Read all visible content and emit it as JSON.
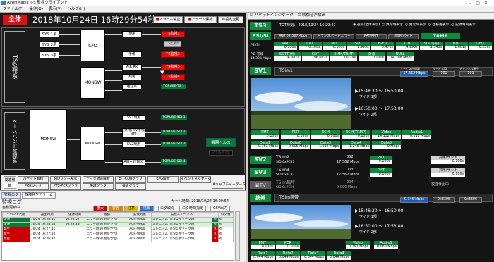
{
  "window": {
    "title": "AvertMagic T-S 監視クライアント"
  },
  "menu": [
    "ファイル(F)",
    "操作(O)",
    "表示(V)",
    "ヘルプ(H)"
  ],
  "left": {
    "zentai": "全体",
    "clock": "2018年10月24日 16時29分54秒",
    "btn_alarm_stop": "アラーム停止",
    "btn_alarm_hold": "アラーム保持",
    "btn_settings": "設定変更",
    "ts_label": "TS監視系",
    "bb_label": "ベースバンド監視系",
    "sys": [
      "SYS 1系",
      "SYS 2系",
      "SYS 3系"
    ],
    "co": "C/O",
    "monsw": "MONSW",
    "lines": [
      "現用",
      "予備",
      "AIR RX",
      "共用",
      "確証系"
    ],
    "ts_red": [
      "TS監視1",
      "TS監視2",
      "TS監視3",
      "TS監視4"
    ],
    "ts_dim": "TS監視5",
    "ts_green1": "TORUBE-TS 1",
    "sv_labels": [
      "SV1現用",
      "(共用) SV予備NT1",
      "SV2現用",
      "AIR+SYDEC"
    ],
    "sdi": [
      "TORUBE-SDI 1",
      "TORUBE-SDI 2",
      "TORUBE-SDI 3",
      "TORUBE-SDI 4"
    ],
    "equip_label": "機器ヘルス",
    "equip_sub": "SYSTEM OK",
    "kanren": "関連機能",
    "keys_row1": [
      "パケット解析",
      "PIDリソー表示",
      "データ放送解析",
      "EIT-CDRグラフ",
      "EPG解析",
      "イベントメッセージ"
    ],
    "keys_row2": [
      "PCRジッタ",
      "PTS-PCRグラフ",
      "帯域グラフ",
      "番組グラフ",
      "キャプチャーデータ"
    ]
  },
  "log": {
    "tabs": [
      "監視ログ",
      "故障発生アラーム"
    ],
    "header": "監視ログ",
    "subheader": "自動更新中",
    "filters": [
      "重大",
      "警告",
      "注意",
      "情報"
    ],
    "btn_copy": "ログ取得",
    "btn_search": "ログ時刻指定",
    "btn_csv": "CSV出力",
    "server_time_label": "サーバ時刻",
    "server_time": "2018/10/24 16:29:54",
    "columns": [
      "イベント内容",
      "発生時刻",
      "復帰時刻",
      "機器",
      "監視対象",
      "監視ステータス",
      "",
      "ログ種"
    ],
    "rows": [
      [
        "復帰",
        "10/24 16:28:51",
        "16:28:52",
        "エラー時刻(地址予告)",
        "ACR-9000",
        "ミレニアム（TS監視ワーク時）",
        "G",
        "有"
      ],
      [
        "復帰",
        "10/24 16:28:14",
        "16:28:48",
        "エラー時刻(地址予告)",
        "ACR-9000",
        "ミレニアム（TS監視ワーク時）",
        "G",
        "有"
      ],
      [
        "発生",
        "10/24 16:27:41",
        "",
        "エラー時刻(地址予告)",
        "ACR-9000",
        "ミレニアム（TS監視ワーク時）",
        "R",
        "有"
      ],
      [
        "発生",
        "10/24 16:27:10",
        "",
        "エラー時刻(地址予告)",
        "ACR-9000",
        "ミレニアム（TS監視ワーク時）",
        "R",
        "有"
      ],
      [
        "発生",
        "10/24 16:26:32",
        "",
        "エラー時刻(地址予告)",
        "ACR-9000",
        "ミレニアム（TS監視ワーク時）",
        "R",
        "有"
      ]
    ]
  },
  "right": {
    "toolbar": [
      "パケットインジケータ",
      "映像音声描画"
    ],
    "ts3": "TS3",
    "tot_label": "TOT時刻：",
    "tot_value": "2018/10/24 16:29:47",
    "radios": [
      "通常(全体表示)",
      "異常時表示",
      "異常時表示",
      "仕様書表示",
      "記録時刻表示"
    ],
    "psisi": "PSI/SI",
    "psisi_row": [
      "帯域 32.507Mbps",
      "トランスポートエラー",
      "PAT/PMT",
      "周期/バイト",
      "TRMP"
    ],
    "psisi_sub": "PSI/SI",
    "cells1": [
      [
        "PAT",
        "0.100s"
      ],
      [
        "CAT",
        "0.100s"
      ],
      [
        "NIT",
        "0.100s"
      ],
      [
        "SDT",
        "1.999s"
      ],
      [
        "H-EIT",
        "0.478s"
      ],
      [
        "TOT",
        "4.998s"
      ],
      [
        "SDTT(拡)",
        "1.343s"
      ],
      [
        "BIT",
        "1.001s"
      ],
      [
        "L-EIT",
        "0.256s"
      ]
    ],
    "cells_label": "PID 帯域",
    "cells_label2": "14.308 Mbps",
    "cells2": [
      [
        "SDTT(例)",
        "36.001s"
      ],
      [
        "CDT",
        "96.667s"
      ],
      [
        "EMM/TRMP",
        "0.029s"
      ],
      [
        "外部",
        "0.100s"
      ],
      [
        "NULL",
        "14.308 Mbps"
      ]
    ],
    "sv1": "SV1",
    "sv1_name": "TSim1",
    "sv1_rate_label": "サービス内帯域",
    "sv1_rate": "17.562 Mbps",
    "sv1_svc_label": "サービスID",
    "sv1_svc": "101",
    "sv1_ch_label": "チャンネル番号",
    "sv1_ch": "101",
    "sv1_prog1": "▶15:48:30 ～ 16:50:00",
    "sv1_prog1_name": "ワイド 1部",
    "sv1_prog2": "▶16:50:00 ～ 17:53:00",
    "sv1_prog2_name": "ワイド 2部",
    "sv1_cells_a": [
      [
        "PMT",
        "0.100s"
      ],
      [
        "PCR",
        "0.100s"
      ],
      [
        "ECM",
        "0.100s"
      ],
      [
        "ECM(TRMP)",
        "0.100s"
      ],
      [
        "Video",
        "14.132 Mbps"
      ],
      [
        "Audio1",
        "0.213 Mbps"
      ]
    ],
    "sv1_cells_b": [
      [
        "Data1",
        "0.753 Mbps"
      ],
      [
        "Data2",
        "0.005 Mbps"
      ],
      [
        "Data3",
        "1.214 Mbps"
      ],
      [
        "Data4",
        "1.245 Mbps"
      ],
      [
        "Data5",
        "0 Mbps"
      ]
    ],
    "sv2": "SV2",
    "sv2_name": "TSim2",
    "sv2_sid": "SID:0x7C21",
    "sv2_no": "002",
    "sv2_rate": "17.562 Mbps",
    "sv2_pmt": [
      "PMT",
      "0.100s"
    ],
    "sv2_shared": [
      "共用/サット",
      "0.100s"
    ],
    "sv3": "SV3",
    "sv3_name": "TSim3",
    "sv3_sid": "SID:0x7C23",
    "sv3_no": "003",
    "sv3_rate": "17.562 Mbps",
    "sv3_pmt": [
      "PMT",
      "0.100s"
    ],
    "sv3_shared": [
      "共用/サット",
      "0.100s"
    ],
    "tv": "TV",
    "tv_name": "TSim臨時",
    "tv_sid": "SID:0x7C26",
    "tv_no": "004",
    "tv_rate": "0.000 Mbps",
    "tv_status": "放送休止中",
    "keitai": "携帯",
    "keitai_name": "TSim携帯",
    "keitai_rate": "0.349 Mbps",
    "keitai_svc": "0x3308",
    "keitai_ch": "0x3306",
    "k_prog1": "▶15:48:30 ～ 16:50:00",
    "k_prog1_name": "ワイド 1部",
    "k_prog2": "▶16:50:00 ～ 17:53:00",
    "k_prog2_name": "ワイド 2部",
    "k_cells_a": [
      [
        "PMT",
        "0.100s"
      ],
      [
        "PCR",
        "0.100s"
      ],
      [
        "Video",
        "0.291 Mbps"
      ],
      [
        "Audio1",
        "0.060 Mbps"
      ]
    ],
    "k_cells_b": [
      [
        "Data1",
        "0.044 Mbps"
      ],
      [
        "Data2",
        "0.044 Mbps"
      ],
      [
        "Data3",
        "0.044 Mbps"
      ],
      [
        "Data4",
        "0.044 Mbps"
      ]
    ]
  }
}
